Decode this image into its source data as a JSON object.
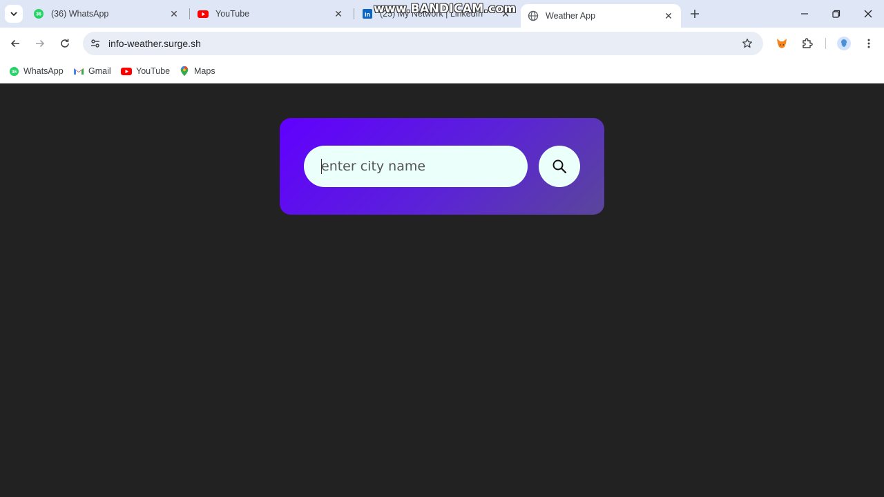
{
  "browser": {
    "tabs": [
      {
        "title": "(36) WhatsApp",
        "icon": "whatsapp-icon",
        "badge": "36"
      },
      {
        "title": "YouTube",
        "icon": "youtube-icon"
      },
      {
        "title": "(25) My Network | LinkedIn",
        "icon": "linkedin-icon",
        "badge": "in"
      },
      {
        "title": "Weather App",
        "icon": "globe-icon",
        "active": true
      }
    ],
    "url": "info-weather.surge.sh",
    "bookmarks": [
      {
        "label": "WhatsApp",
        "icon": "whatsapp-icon",
        "badge": "36"
      },
      {
        "label": "Gmail",
        "icon": "gmail-icon"
      },
      {
        "label": "YouTube",
        "icon": "youtube-icon"
      },
      {
        "label": "Maps",
        "icon": "maps-icon"
      }
    ]
  },
  "watermark": "www.BANDICAM.com",
  "weather_app": {
    "search": {
      "placeholder": "enter city name",
      "value": ""
    }
  },
  "colors": {
    "page_background": "#222222",
    "card_gradient_start": "#6100ff",
    "card_gradient_end": "#5a469a",
    "input_background": "#ebfffb",
    "tabstrip_background": "#dfe6f5"
  }
}
